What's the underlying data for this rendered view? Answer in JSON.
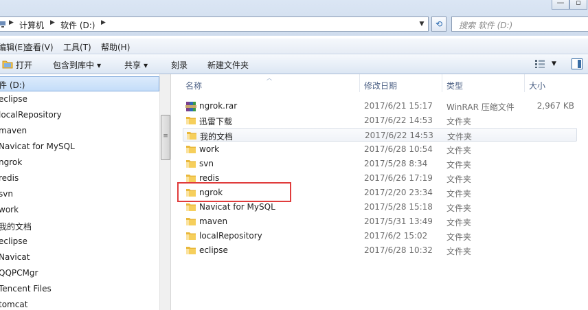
{
  "address": {
    "segments": [
      "计算机",
      "软件 (D:)"
    ]
  },
  "search": {
    "placeholder": "搜索 软件 (D:)"
  },
  "menu": [
    "编辑(E)",
    "查看(V)",
    "工具(T)",
    "帮助(H)"
  ],
  "toolbar": {
    "open": "打开",
    "include_library": "包含到库中",
    "share": "共享",
    "burn": "刻录",
    "new_folder": "新建文件夹"
  },
  "nav": {
    "selected": "件 (D:)",
    "items": [
      "eclipse",
      "localRepository",
      "maven",
      "Navicat for MySQL",
      "ngrok",
      "redis",
      "svn",
      "work",
      "我的文档",
      "eclipse",
      "Navicat",
      "QQPCMgr",
      "Tencent Files",
      "tomcat"
    ]
  },
  "columns": {
    "name": "名称",
    "date": "修改日期",
    "type": "类型",
    "size": "大小"
  },
  "files": [
    {
      "name": "ngrok.rar",
      "date": "2017/6/21 15:17",
      "type": "WinRAR 压缩文件",
      "size": "2,967 KB",
      "icon": "rar-archive-icon"
    },
    {
      "name": "迅雷下载",
      "date": "2017/6/22 14:53",
      "type": "文件夹",
      "size": "",
      "icon": "folder-icon"
    },
    {
      "name": "我的文档",
      "date": "2017/6/22 14:53",
      "type": "文件夹",
      "size": "",
      "icon": "folder-icon"
    },
    {
      "name": "work",
      "date": "2017/6/28 10:54",
      "type": "文件夹",
      "size": "",
      "icon": "folder-icon"
    },
    {
      "name": "svn",
      "date": "2017/5/28 8:34",
      "type": "文件夹",
      "size": "",
      "icon": "folder-icon"
    },
    {
      "name": "redis",
      "date": "2017/6/26 17:19",
      "type": "文件夹",
      "size": "",
      "icon": "folder-icon"
    },
    {
      "name": "ngrok",
      "date": "2017/2/20 23:34",
      "type": "文件夹",
      "size": "",
      "icon": "folder-icon"
    },
    {
      "name": "Navicat for MySQL",
      "date": "2017/5/28 15:18",
      "type": "文件夹",
      "size": "",
      "icon": "folder-icon"
    },
    {
      "name": "maven",
      "date": "2017/5/31 13:49",
      "type": "文件夹",
      "size": "",
      "icon": "folder-icon"
    },
    {
      "name": "localRepository",
      "date": "2017/6/2 15:02",
      "type": "文件夹",
      "size": "",
      "icon": "folder-icon"
    },
    {
      "name": "eclipse",
      "date": "2017/6/28 10:32",
      "type": "文件夹",
      "size": "",
      "icon": "folder-icon"
    }
  ],
  "colors": {
    "highlight_box": "#e03c3c",
    "folder": "#f2c34a",
    "header_text": "#4d6185"
  }
}
